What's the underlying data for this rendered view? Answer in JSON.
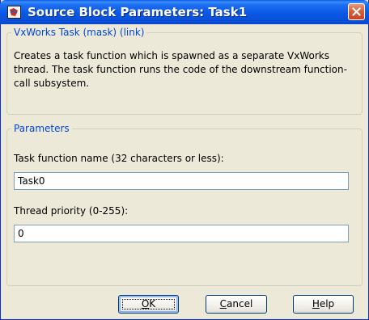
{
  "window": {
    "title": "Source Block Parameters: Task1",
    "title_icon": "simulink-block-icon",
    "close_icon": "close-icon"
  },
  "mask_group": {
    "legend": "VxWorks Task (mask) (link)",
    "description": "Creates a task function which is spawned as a separate VxWorks thread. The task function runs the code of the downstream function-call subsystem."
  },
  "parameters_group": {
    "legend": "Parameters",
    "task_name_label": "Task function name (32 characters or less):",
    "task_name_value": "Task0",
    "priority_label": "Thread priority (0-255):",
    "priority_value": "0"
  },
  "buttons": {
    "ok": {
      "mnemonic": "O",
      "rest": "K"
    },
    "cancel": {
      "mnemonic": "C",
      "rest": "ancel"
    },
    "help": {
      "mnemonic": "H",
      "rest": "elp"
    }
  },
  "colors": {
    "titlebar": "#0a58e4",
    "dialog_bg": "#ece9d8",
    "legend_text": "#0046d5",
    "close_button": "#d8603e"
  }
}
